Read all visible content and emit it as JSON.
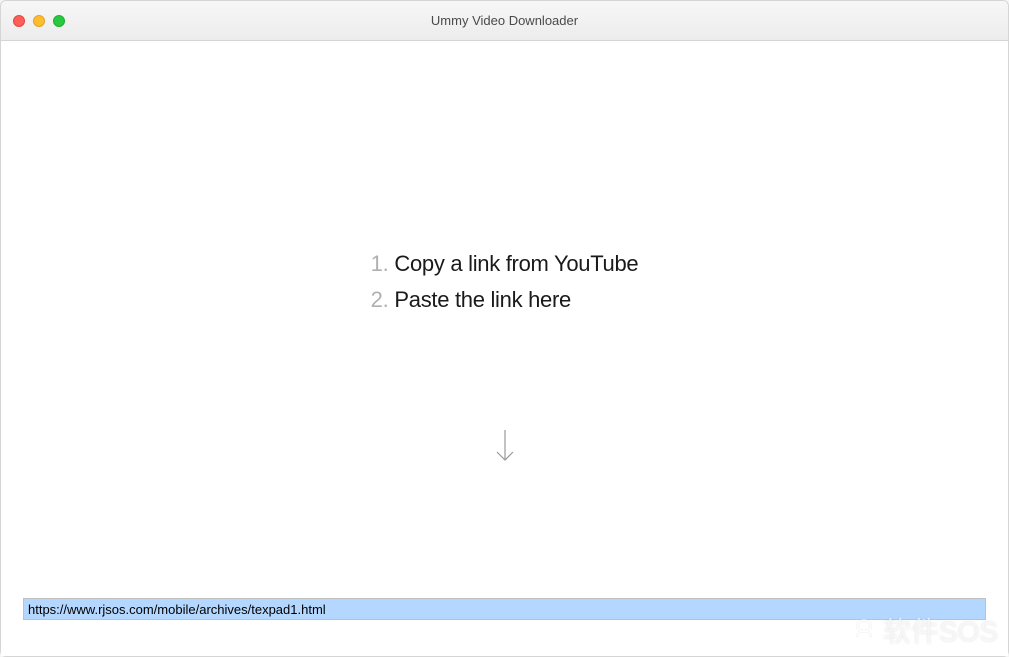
{
  "window": {
    "title": "Ummy Video Downloader"
  },
  "instructions": {
    "step1_num": "1.",
    "step1_text": "Copy a link from YouTube",
    "step2_num": "2.",
    "step2_text": "Paste the link here"
  },
  "url_input": {
    "value": "https://www.rjsos.com/mobile/archives/texpad1.html"
  },
  "watermark": {
    "text": "软件SOS"
  }
}
